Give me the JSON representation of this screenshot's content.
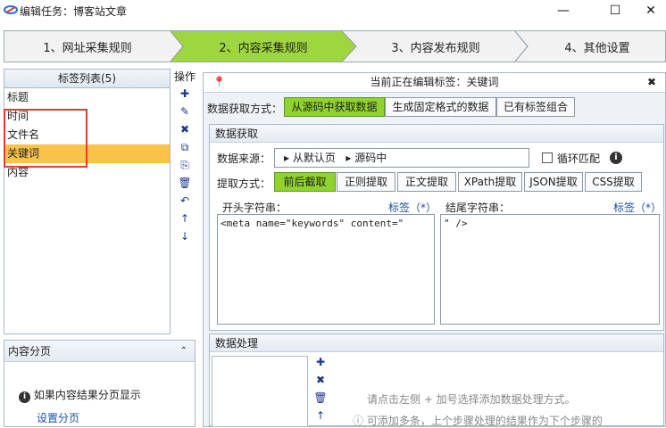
{
  "window": {
    "title": "编辑任务：博客站文章",
    "minimize": "—",
    "maximize": "☐",
    "close": "✕"
  },
  "steps": [
    "1、网址采集规则",
    "2、内容采集规则",
    "3、内容发布规则",
    "4、其他设置"
  ],
  "tag_list": {
    "header": "标签列表(5)",
    "items": [
      "标题",
      "时间",
      "文件名",
      "关键词",
      "内容"
    ],
    "selected": 3
  },
  "ops": {
    "header": "操作",
    "icons": [
      "add-icon",
      "edit-icon",
      "delete-icon",
      "copy-icon",
      "paste-icon",
      "trash-icon",
      "undo-icon",
      "up-arrow-icon",
      "down-arrow-icon"
    ]
  },
  "ops_glyphs": [
    "✚",
    "✎",
    "✖",
    "⧉",
    "⎘",
    "🗑",
    "↶",
    "↑",
    "↓"
  ],
  "pagination": {
    "header": "内容分页",
    "info": "如果内容结果分页显示",
    "link": "设置分页"
  },
  "editor": {
    "header": "当前正在编辑标签：关键词",
    "fetch_mode_label": "数据获取方式：",
    "fetch_modes": [
      "从源码中获取数据",
      "生成固定格式的数据",
      "已有标签组合"
    ],
    "fetch_section": "数据获取",
    "source_label": "数据来源：",
    "source_path": [
      "从默认页",
      "源码中"
    ],
    "loop_label": "循环匹配",
    "extract_label": "提取方式：",
    "extract_modes": [
      "前后截取",
      "正则提取",
      "正文提取",
      "XPath提取",
      "JSON提取",
      "CSS提取"
    ],
    "start_label": "开头字符串：",
    "end_label": "结尾字符串：",
    "tag_link": "标签（*）",
    "start_value": "<meta name=\"keywords\" content=\"",
    "end_value": "\" />",
    "process_section": "数据处理",
    "process_hint": "请点击左侧 + 加号选择添加数据处理方式。",
    "process_hint2": "可添加多条，上个步骤处理的结果作为下个步骤的"
  }
}
